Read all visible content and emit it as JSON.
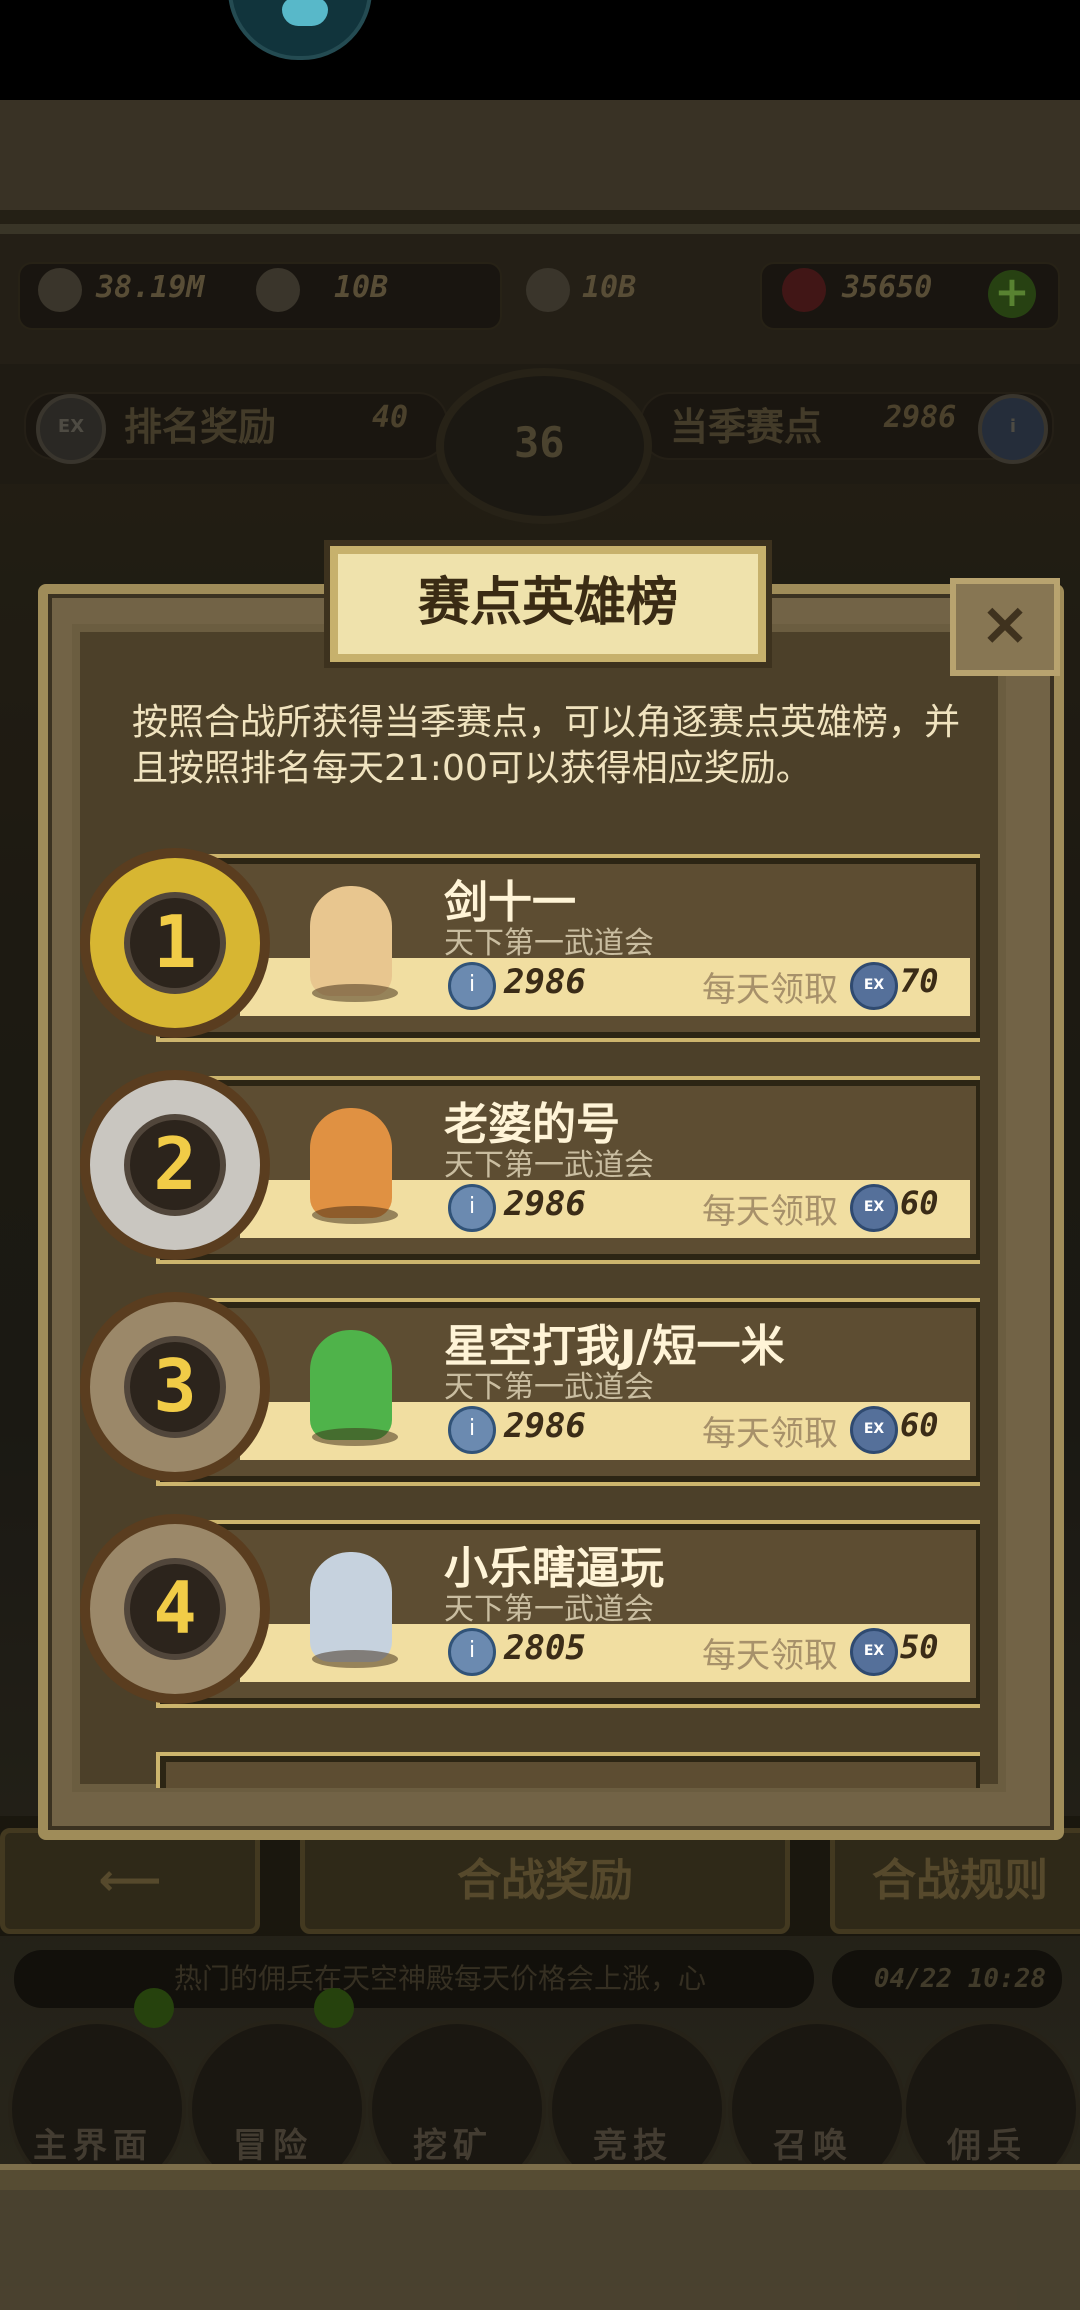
{
  "resources": {
    "power": "38.19M",
    "exp": "10B",
    "coins": "10B",
    "gems": "35650"
  },
  "rank_bar": {
    "left_label": "排名奖励",
    "left_value": "40",
    "emblem": "36",
    "right_label": "当季赛点",
    "right_value": "2986"
  },
  "modal": {
    "title": "赛点英雄榜",
    "close": "×",
    "description": "按照合战所获得当季赛点，可以角逐赛点英雄榜，并且按照排名每天21:00可以获得相应奖励。"
  },
  "leaderboard": [
    {
      "rank": "1",
      "name": "剑十一",
      "guild": "天下第一武道会",
      "points": "2986",
      "daily_label": "每天领取",
      "reward": "70"
    },
    {
      "rank": "2",
      "name": "老婆的号",
      "guild": "天下第一武道会",
      "points": "2986",
      "daily_label": "每天领取",
      "reward": "60"
    },
    {
      "rank": "3",
      "name": "星空打我J/短一米",
      "guild": "天下第一武道会",
      "points": "2986",
      "daily_label": "每天领取",
      "reward": "60"
    },
    {
      "rank": "4",
      "name": "小乐瞎逼玩",
      "guild": "天下第一武道会",
      "points": "2805",
      "daily_label": "每天领取",
      "reward": "50"
    }
  ],
  "bottom": {
    "back_arrow": "⟵",
    "battle_rewards": "合战奖励",
    "battle_rules": "合战规则",
    "ticker": "热门的佣兵在天空神殿每天价格会上涨，心",
    "time": "04/22 10:28",
    "nav": [
      "主界面",
      "冒险",
      "挖矿",
      "竞技",
      "召唤",
      "佣兵"
    ]
  },
  "colors": {
    "gold_medal": "#d7b632",
    "silver_medal": "#c9c6c0",
    "bronze_medal": "#9b8869",
    "title_plate": "#efe2ac",
    "card_bg": "#5d4d32"
  }
}
